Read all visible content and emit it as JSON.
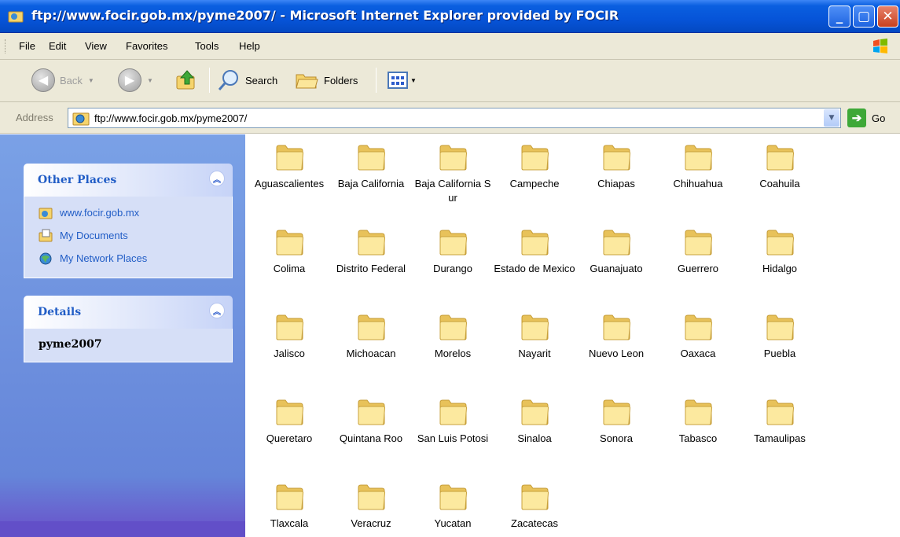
{
  "window": {
    "title": "ftp://www.focir.gob.mx/pyme2007/ - Microsoft Internet Explorer provided by FOCIR",
    "controls": {
      "minimize": "minimize-icon",
      "maximize": "maximize-icon",
      "close": "close-icon"
    }
  },
  "menu": [
    "File",
    "Edit",
    "View",
    "Favorites",
    "Tools",
    "Help"
  ],
  "toolbar": {
    "back_label": "Back",
    "search_label": "Search",
    "folders_label": "Folders",
    "icons": [
      "back-icon",
      "forward-icon",
      "up-folder-icon",
      "search-icon",
      "folders-icon",
      "views-icon"
    ]
  },
  "address": {
    "label": "Address",
    "value": "ftp://www.focir.gob.mx/pyme2007/",
    "go_label": "Go"
  },
  "sidebar": {
    "other_places": {
      "title": "Other Places",
      "items": [
        "www.focir.gob.mx",
        "My Documents",
        "My Network Places"
      ]
    },
    "details": {
      "title": "Details",
      "name": "pyme2007"
    }
  },
  "folders": [
    "Aguascalientes",
    "Baja California",
    "Baja California Sur",
    "Campeche",
    "Chiapas",
    "Chihuahua",
    "Coahuila",
    "Colima",
    "Distrito Federal",
    "Durango",
    "Estado de Mexico",
    "Guanajuato",
    "Guerrero",
    "Hidalgo",
    "Jalisco",
    "Michoacan",
    "Morelos",
    "Nayarit",
    "Nuevo Leon",
    "Oaxaca",
    "Puebla",
    "Queretaro",
    "Quintana Roo",
    "San Luis Potosi",
    "Sinaloa",
    "Sonora",
    "Tabasco",
    "Tamaulipas",
    "Tlaxcala",
    "Veracruz",
    "Yucatan",
    "Zacatecas"
  ],
  "colors": {
    "title_bar": "#0654d8",
    "chrome": "#ece9d8",
    "task_pane": "#7aa1e6",
    "link_blue": "#215dc6"
  }
}
